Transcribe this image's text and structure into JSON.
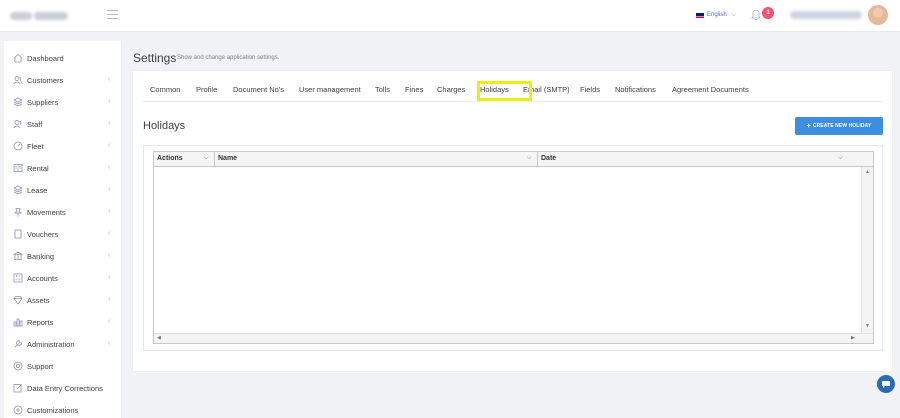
{
  "topbar": {
    "language": "English",
    "notification_count": "1"
  },
  "sidebar": {
    "items": [
      {
        "label": "Dashboard",
        "icon": "home-icon",
        "arrow": false
      },
      {
        "label": "Customers",
        "icon": "users-icon",
        "arrow": true
      },
      {
        "label": "Suppliers",
        "icon": "layers-icon",
        "arrow": true
      },
      {
        "label": "Staff",
        "icon": "users-icon",
        "arrow": true
      },
      {
        "label": "Fleet",
        "icon": "speedometer-icon",
        "arrow": true
      },
      {
        "label": "Rental",
        "icon": "book-icon",
        "arrow": true
      },
      {
        "label": "Lease",
        "icon": "layers-icon",
        "arrow": true
      },
      {
        "label": "Movements",
        "icon": "pin-icon",
        "arrow": true
      },
      {
        "label": "Vouchers",
        "icon": "document-icon",
        "arrow": true
      },
      {
        "label": "Banking",
        "icon": "bank-icon",
        "arrow": true
      },
      {
        "label": "Accounts",
        "icon": "calculator-icon",
        "arrow": true
      },
      {
        "label": "Assets",
        "icon": "diamond-icon",
        "arrow": true
      },
      {
        "label": "Reports",
        "icon": "chart-icon",
        "arrow": true
      },
      {
        "label": "Administration",
        "icon": "wrench-icon",
        "arrow": true
      },
      {
        "label": "Support",
        "icon": "support-icon",
        "arrow": false
      },
      {
        "label": "Data Entry Corrections",
        "icon": "edit-icon",
        "arrow": false
      },
      {
        "label": "Customizations",
        "icon": "plus-circle-icon",
        "arrow": false
      }
    ]
  },
  "page": {
    "title": "Settings",
    "subtitle": "Show and change application settings."
  },
  "tabs": [
    "Common",
    "Profile",
    "Document No's",
    "User management",
    "Tolls",
    "Fines",
    "Charges",
    "Holidays",
    "Email (SMTP)",
    "Fields",
    "Notifications",
    "Agreement Documents"
  ],
  "active_tab": "Holidays",
  "section": {
    "title": "Holidays",
    "create_button": "CREATE NEW HOLIDAY"
  },
  "grid": {
    "columns": [
      "Actions",
      "Name",
      "Date"
    ]
  },
  "colors": {
    "accent": "#5867dd",
    "button": "#3d8ee0",
    "highlight": "#f0ec0c",
    "badge": "#f4516c"
  }
}
